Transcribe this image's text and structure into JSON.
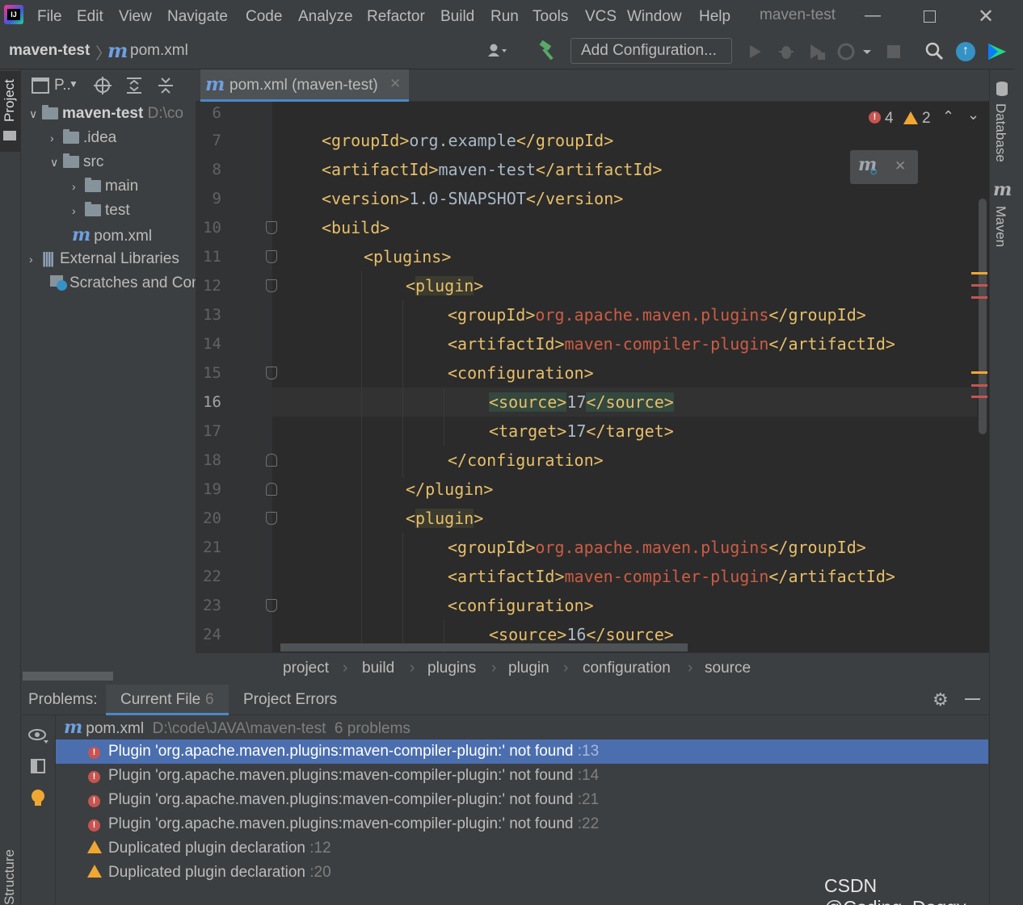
{
  "menu": [
    "File",
    "Edit",
    "View",
    "Navigate",
    "Code",
    "Analyze",
    "Refactor",
    "Build",
    "Run",
    "Tools",
    "VCS",
    "Window",
    "Help"
  ],
  "window_title": "maven-test",
  "nav": {
    "project": "maven-test",
    "file": "pom.xml",
    "add_config": "Add Configuration..."
  },
  "left_stripe": {
    "project": "Project",
    "structure": "Structure"
  },
  "right_stripe": {
    "database": "Database",
    "maven": "Maven"
  },
  "project_panel": {
    "header": "P..",
    "root": "maven-test",
    "root_path": "D:\\co",
    "items": [
      ".idea",
      "src",
      "main",
      "test",
      "pom.xml",
      "External Libraries",
      "Scratches and Con"
    ]
  },
  "editor": {
    "tab": "pom.xml (maven-test)",
    "error_count": "4",
    "warning_count": "2",
    "maven_logo": "m",
    "lines": [
      {
        "n": "6"
      },
      {
        "n": "7"
      },
      {
        "n": "8"
      },
      {
        "n": "9"
      },
      {
        "n": "10"
      },
      {
        "n": "11"
      },
      {
        "n": "12"
      },
      {
        "n": "13"
      },
      {
        "n": "14"
      },
      {
        "n": "15"
      },
      {
        "n": "16"
      },
      {
        "n": "17"
      },
      {
        "n": "18"
      },
      {
        "n": "19"
      },
      {
        "n": "20"
      },
      {
        "n": "21"
      },
      {
        "n": "22"
      },
      {
        "n": "23"
      },
      {
        "n": "24"
      }
    ],
    "code": {
      "l7": [
        "<groupId>",
        "org.example",
        "</groupId>"
      ],
      "l8": [
        "<artifactId>",
        "maven-test",
        "</artifactId>"
      ],
      "l9": [
        "<version>",
        "1.0-SNAPSHOT",
        "</version>"
      ],
      "l10": "<build>",
      "l11": "<plugins>",
      "l12": [
        "<",
        "plugin",
        ">"
      ],
      "l13": [
        "<groupId>",
        "org.apache.maven.plugins",
        "</groupId>"
      ],
      "l14": [
        "<artifactId>",
        "maven-compiler-plugin",
        "</artifactId>"
      ],
      "l15": "<configuration>",
      "l16": [
        "<source>",
        "17",
        "</source>"
      ],
      "l17": [
        "<target>",
        "17",
        "</target>"
      ],
      "l18": "</configuration>",
      "l19": "</plugin>",
      "l20": [
        "<",
        "plugin",
        ">"
      ],
      "l21": [
        "<groupId>",
        "org.apache.maven.plugins",
        "</groupId>"
      ],
      "l22": [
        "<artifactId>",
        "maven-compiler-plugin",
        "</artifactId>"
      ],
      "l23": "<configuration>",
      "l24": [
        "<source>",
        "16",
        "</source>"
      ]
    }
  },
  "breadcrumb": [
    "project",
    "build",
    "plugins",
    "plugin",
    "configuration",
    "source"
  ],
  "problems": {
    "label": "Problems:",
    "tabs": [
      {
        "label": "Current File",
        "count": "6"
      },
      {
        "label": "Project Errors"
      }
    ],
    "file": "pom.xml",
    "file_path": "D:\\code\\JAVA\\maven-test",
    "file_count": "6 problems",
    "items": [
      {
        "type": "error",
        "text": "Plugin 'org.apache.maven.plugins:maven-compiler-plugin:' not found",
        "line": ":13"
      },
      {
        "type": "error",
        "text": "Plugin 'org.apache.maven.plugins:maven-compiler-plugin:' not found",
        "line": ":14"
      },
      {
        "type": "error",
        "text": "Plugin 'org.apache.maven.plugins:maven-compiler-plugin:' not found",
        "line": ":21"
      },
      {
        "type": "error",
        "text": "Plugin 'org.apache.maven.plugins:maven-compiler-plugin:' not found",
        "line": ":22"
      },
      {
        "type": "warning",
        "text": "Duplicated plugin declaration",
        "line": ":12"
      },
      {
        "type": "warning",
        "text": "Duplicated plugin declaration",
        "line": ":20"
      }
    ]
  },
  "watermark": "CSDN @Coding_Doggy",
  "colors": {
    "accent": "#4a88c7",
    "selection": "#4b6eaf",
    "error": "#c75450",
    "warning": "#f0a732",
    "tag": "#e8bf6a",
    "bg": "#2b2b2b"
  }
}
